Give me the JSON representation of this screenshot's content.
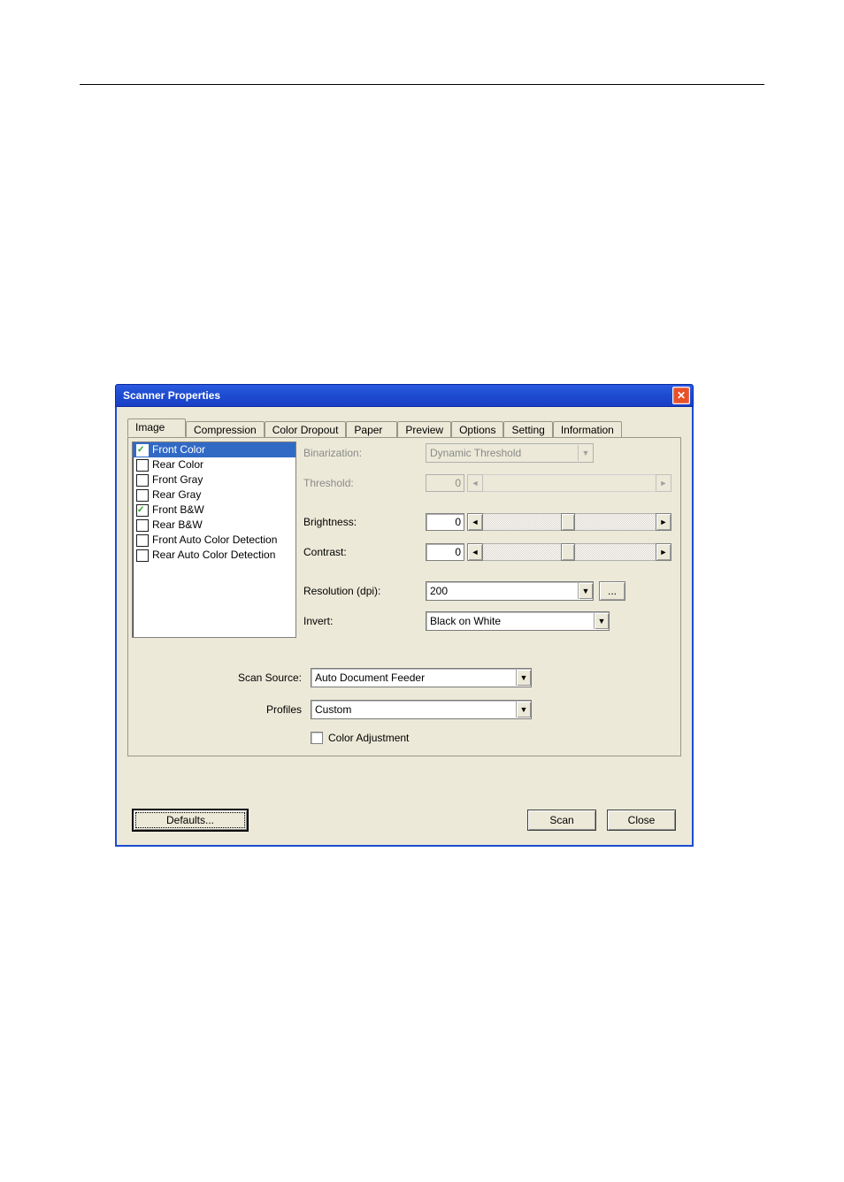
{
  "window": {
    "title": "Scanner Properties"
  },
  "tabs": [
    "Image",
    "Compression",
    "Color Dropout",
    "Paper",
    "Preview",
    "Options",
    "Setting",
    "Information"
  ],
  "active_tab_index": 0,
  "image_list": [
    {
      "label": "Front Color",
      "checked": true,
      "selected": true
    },
    {
      "label": "Rear Color",
      "checked": false,
      "selected": false
    },
    {
      "label": "Front Gray",
      "checked": false,
      "selected": false
    },
    {
      "label": "Rear Gray",
      "checked": false,
      "selected": false
    },
    {
      "label": "Front B&W",
      "checked": true,
      "selected": false
    },
    {
      "label": "Rear B&W",
      "checked": false,
      "selected": false
    },
    {
      "label": "Front Auto Color Detection",
      "checked": false,
      "selected": false
    },
    {
      "label": "Rear Auto Color Detection",
      "checked": false,
      "selected": false
    }
  ],
  "labels": {
    "binarization": "Binarization:",
    "threshold": "Threshold:",
    "brightness": "Brightness:",
    "contrast": "Contrast:",
    "resolution": "Resolution (dpi):",
    "invert": "Invert:",
    "scan_source": "Scan Source:",
    "profiles": "Profiles",
    "color_adjustment": "Color Adjustment"
  },
  "values": {
    "binarization": "Dynamic Threshold",
    "threshold": "0",
    "brightness": "0",
    "contrast": "0",
    "resolution": "200",
    "invert": "Black on White",
    "scan_source": "Auto Document Feeder",
    "profiles": "Custom",
    "color_adjustment_checked": false,
    "resolution_more": "..."
  },
  "buttons": {
    "defaults": "Defaults...",
    "scan": "Scan",
    "close": "Close"
  }
}
